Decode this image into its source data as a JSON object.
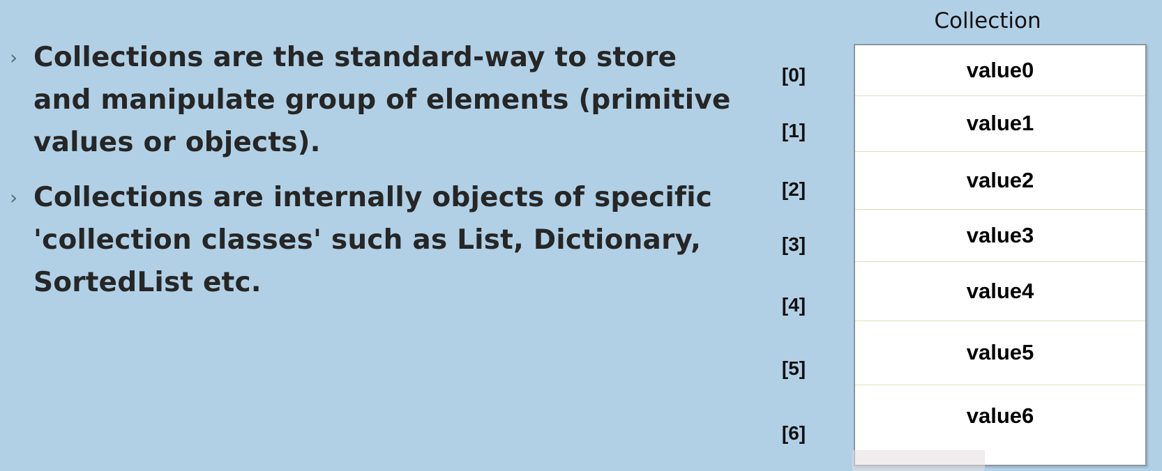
{
  "bullets": [
    {
      "marker": "›",
      "lines": [
        "Collections are the standard-way to store",
        "and manipulate group of elements (primitive",
        "values or objects)."
      ]
    },
    {
      "marker": "›",
      "lines": [
        "Collections are internally objects of specific",
        "'collection classes' such as List, Dictionary,",
        "SortedList etc."
      ]
    }
  ],
  "collection": {
    "title": "Collection",
    "items": [
      {
        "index": "[0]",
        "value": "value0"
      },
      {
        "index": "[1]",
        "value": "value1"
      },
      {
        "index": "[2]",
        "value": "value2"
      },
      {
        "index": "[3]",
        "value": "value3"
      },
      {
        "index": "[4]",
        "value": "value4"
      },
      {
        "index": "[5]",
        "value": "value5"
      },
      {
        "index": "[6]",
        "value": "value6"
      }
    ]
  },
  "colors": {
    "background": "#b1d0e6",
    "box": "#ffffff",
    "divider": "#d6e3b8"
  }
}
